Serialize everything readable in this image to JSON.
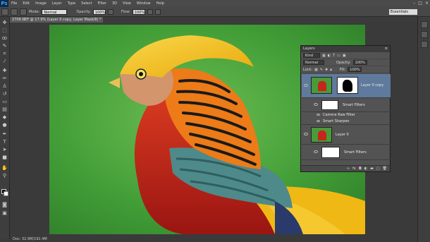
{
  "app": {
    "logo": "Ps"
  },
  "menu": [
    "File",
    "Edit",
    "Image",
    "Layer",
    "Type",
    "Select",
    "Filter",
    "3D",
    "View",
    "Window",
    "Help"
  ],
  "window_controls": [
    "–",
    "□",
    "×"
  ],
  "options_bar": {
    "mode_label": "Mode:",
    "mode_value": "Normal",
    "opacity_label": "Opacity:",
    "opacity_value": "100%",
    "flow_label": "Flow:",
    "flow_value": "100%",
    "workspace": "Essentials"
  },
  "document": {
    "tab_title": "2709.NEF @ 17.9% (Layer 0 copy, Layer Mask/8) *",
    "status": "Doc: 32.9M/192.4M",
    "photo_subject": "golden pheasant"
  },
  "tools": [
    "move",
    "marquee",
    "lasso",
    "quick-select",
    "crop",
    "eyedropper",
    "healing",
    "brush",
    "stamp",
    "history",
    "eraser",
    "gradient",
    "blur",
    "dodge",
    "pen",
    "type",
    "path-select",
    "shape",
    "hand",
    "zoom"
  ],
  "layers_panel": {
    "title": "Layers",
    "filter_label": "Kind",
    "blend_mode": "Normal",
    "opacity_label": "Opacity:",
    "opacity_value": "100%",
    "lock_label": "Lock:",
    "fill_label": "Fill:",
    "fill_value": "100%",
    "layers": [
      {
        "name": "Layer 0 copy",
        "selected": true,
        "has_mask": true
      },
      {
        "name": "Smart Filters",
        "sub": true
      },
      {
        "name": "Camera Raw Filter",
        "filter": true
      },
      {
        "name": "Smart Sharpen",
        "filter": true
      },
      {
        "name": "Layer 0",
        "selected": false,
        "has_mask": false
      },
      {
        "name": "Smart Filters",
        "sub": true
      }
    ],
    "footer_icons": [
      "link",
      "fx",
      "mask",
      "adjust",
      "group",
      "new",
      "delete"
    ]
  },
  "colors": {
    "accent_selected": "#5f7a9c",
    "background_green": "#4a9a3a",
    "feather_yellow": "#f2c21a",
    "breast_red": "#c5251a",
    "neck_orange": "#ec7b18",
    "scale_teal": "#4e8a8a"
  }
}
